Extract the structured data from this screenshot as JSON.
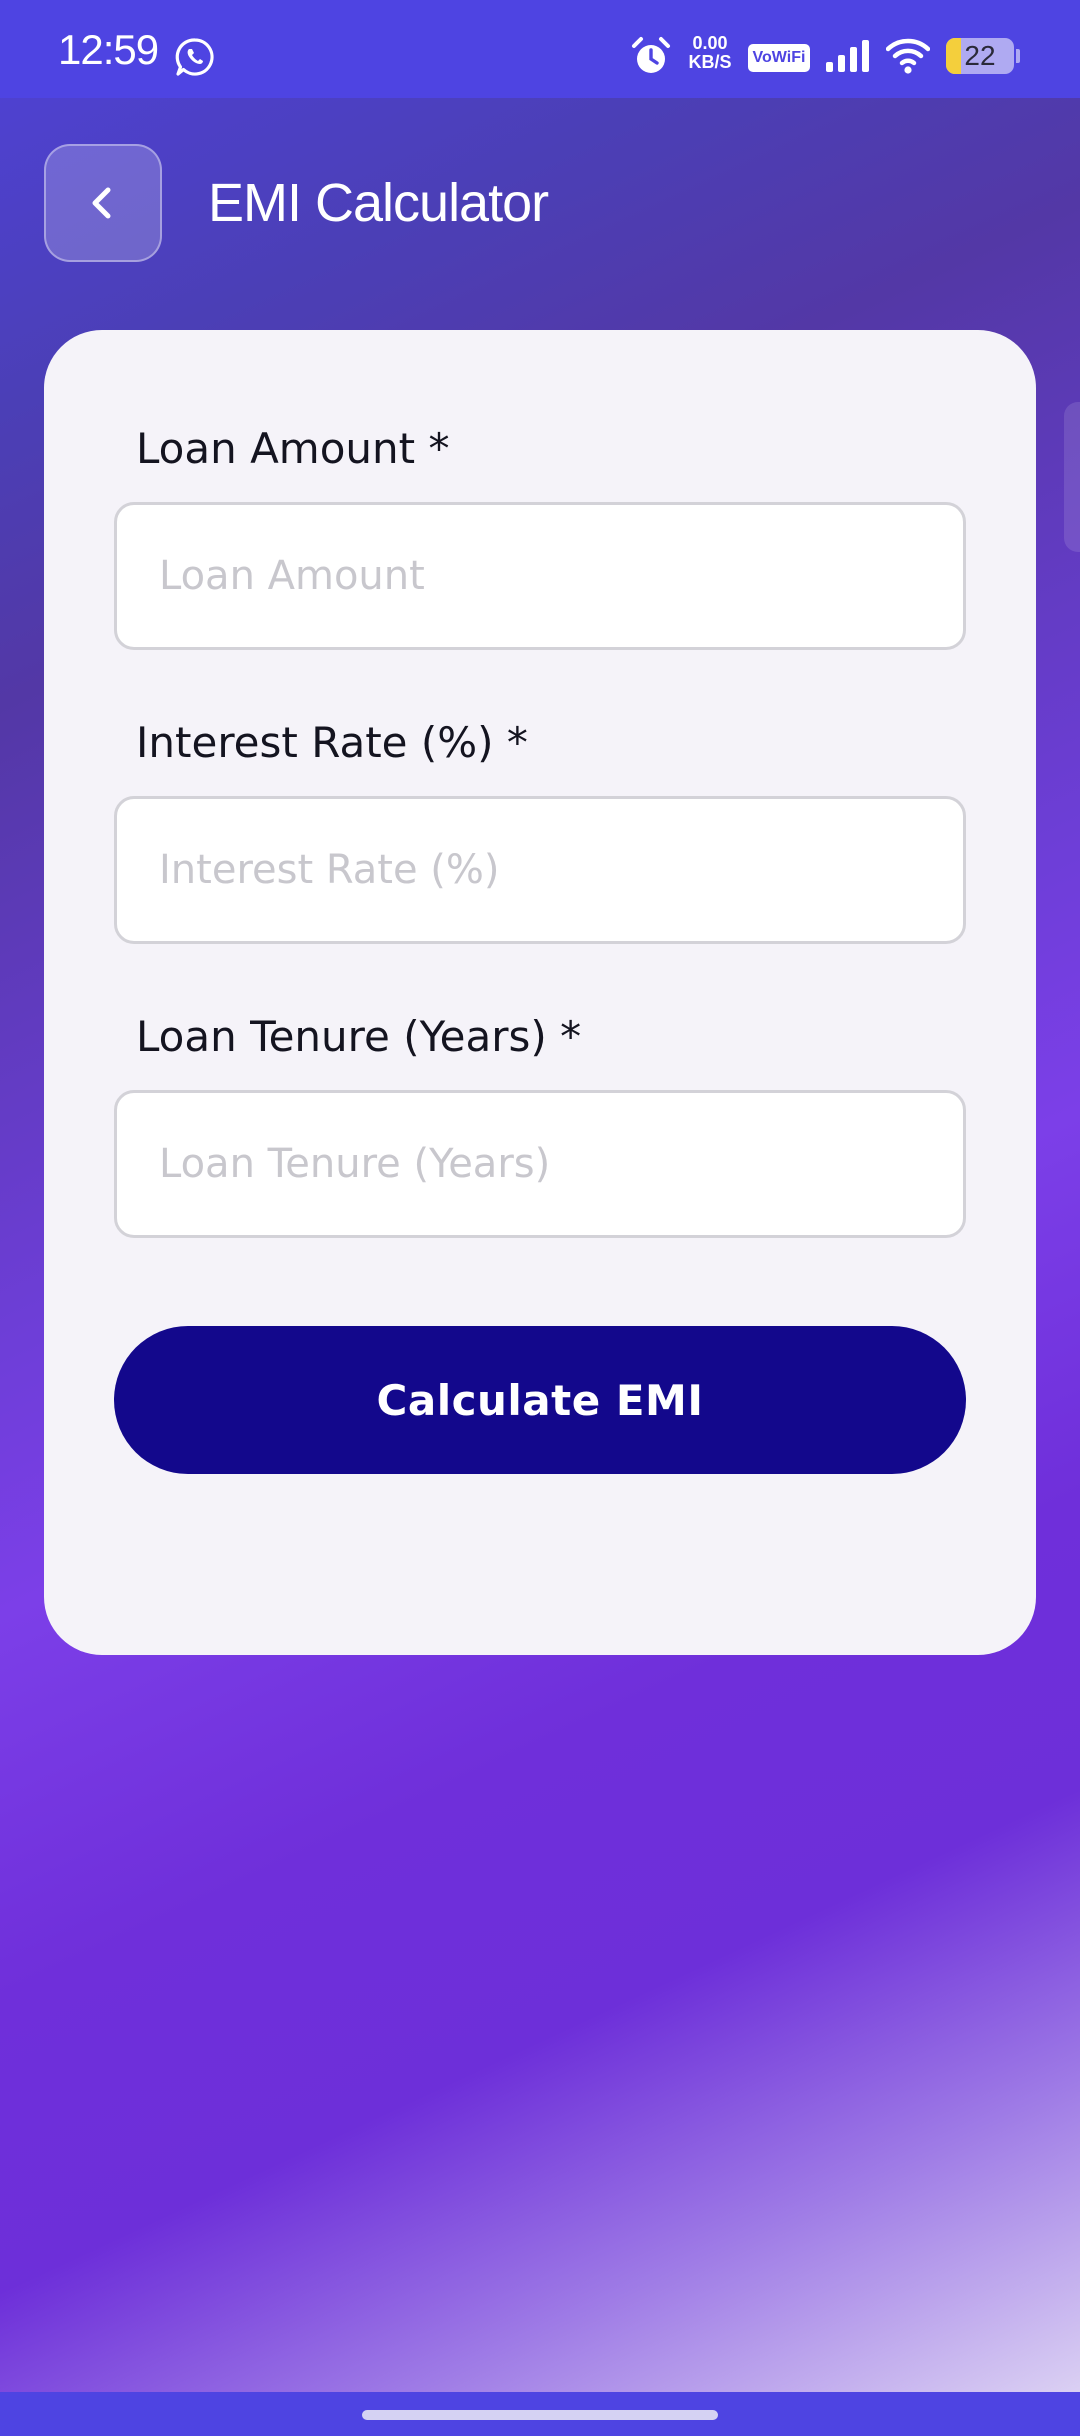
{
  "status_bar": {
    "time": "12:59",
    "network_speed_value": "0.00",
    "network_speed_unit": "KB/S",
    "vowifi": "VoWiFi",
    "battery": "22",
    "battery_level": 0.22,
    "icons": [
      "whatsapp-icon",
      "alarm-icon",
      "signal-icon",
      "wifi-icon",
      "battery-icon"
    ]
  },
  "header": {
    "title": "EMI Calculator",
    "back_icon": "chevron-left-icon"
  },
  "form": {
    "fields": [
      {
        "label": "Loan Amount *",
        "placeholder": "Loan Amount",
        "value": ""
      },
      {
        "label": "Interest Rate (%) *",
        "placeholder": "Interest Rate (%)",
        "value": ""
      },
      {
        "label": "Loan Tenure (Years) *",
        "placeholder": "Loan Tenure (Years)",
        "value": ""
      }
    ],
    "submit_label": "Calculate EMI"
  },
  "colors": {
    "status_bar": "#4e44e2",
    "card": "#f5f3f9",
    "button": "#13088c",
    "label": "#141420",
    "placeholder": "#c8c7cd"
  }
}
